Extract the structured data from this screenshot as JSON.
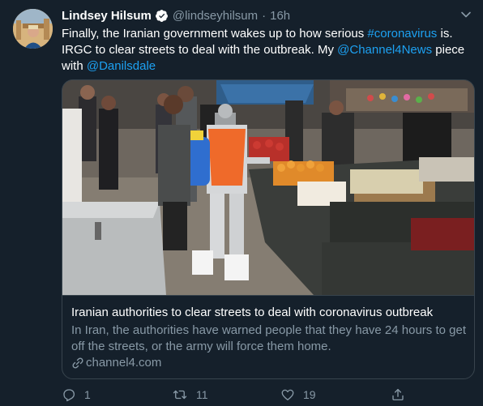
{
  "tweet": {
    "author": {
      "display_name": "Lindsey Hilsum",
      "handle": "@lindseyhilsum",
      "verified": true,
      "avatar_icon": "profile-photo"
    },
    "time_separator": "·",
    "time": "16h",
    "text": {
      "part1": "Finally, the Iranian government wakes up to how serious ",
      "hashtag": "#coronavirus",
      "part2": " is. IRGC to clear streets to deal with the outbreak. My ",
      "mention1": "@Channel4News",
      "part3": " piece with ",
      "mention2": "@Danilsdale"
    },
    "card": {
      "title": "Iranian authorities to clear streets to deal with coronavirus outbreak",
      "description": "In Iran, the authorities have warned people that they have 24 hours to get off the streets, or the army will force them home.",
      "domain": "channel4.com",
      "image_icon": "street-market-disinfection-photo"
    },
    "actions": {
      "reply_count": "1",
      "retweet_count": "11",
      "like_count": "19"
    }
  },
  "colors": {
    "background": "#15202b",
    "link": "#1da1f2",
    "secondary_text": "#8899a6",
    "border": "#38444d",
    "verified_badge": "#ffffff"
  }
}
